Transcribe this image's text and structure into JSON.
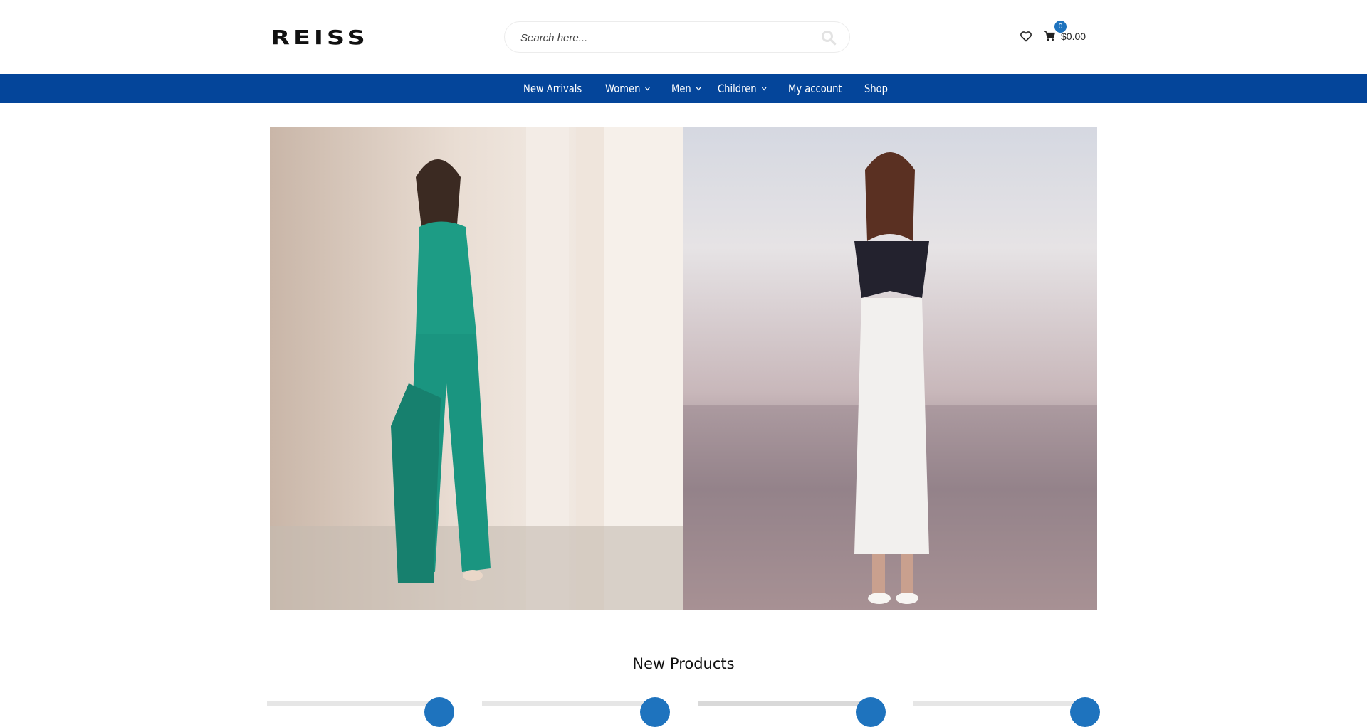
{
  "brand": {
    "logo_text": "REISS"
  },
  "search": {
    "placeholder": "Search here...",
    "icon": "search-icon"
  },
  "header_actions": {
    "wishlist_icon": "heart-icon",
    "cart_icon": "cart-icon",
    "cart_count": "0",
    "cart_total": "$0.00"
  },
  "nav": {
    "items": [
      {
        "label": "New Arrivals",
        "has_dropdown": false
      },
      {
        "label": "Women",
        "has_dropdown": true
      },
      {
        "label": "Men",
        "has_dropdown": true
      },
      {
        "label": "Children",
        "has_dropdown": true
      },
      {
        "label": "My account",
        "has_dropdown": false
      },
      {
        "label": "Shop",
        "has_dropdown": false
      }
    ]
  },
  "section": {
    "title": "New Products"
  },
  "colors": {
    "nav_bg": "#04459a",
    "accent": "#1e73be"
  }
}
